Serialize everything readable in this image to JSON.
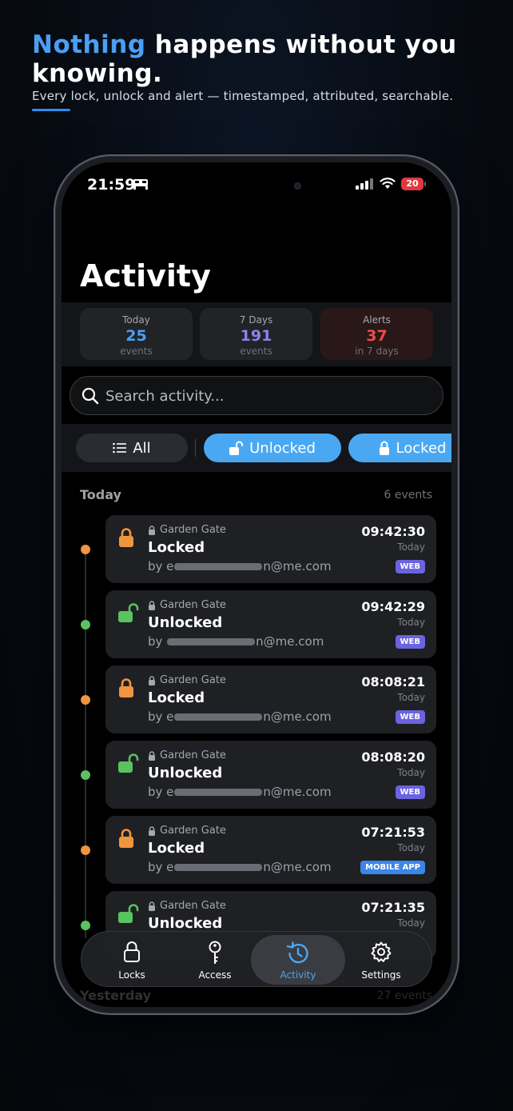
{
  "marketing": {
    "headline_accent": "Nothing",
    "headline_rest": " happens without you knowing.",
    "subline": "Every lock, unlock and alert — timestamped, attributed, searchable."
  },
  "status_bar": {
    "time": "21:59",
    "battery": "20"
  },
  "page_title": "Activity",
  "stats": [
    {
      "label": "Today",
      "value": "25",
      "sub": "events",
      "color": "#4a9ff5"
    },
    {
      "label": "7 Days",
      "value": "191",
      "sub": "events",
      "color": "#8b84f0"
    },
    {
      "label": "Alerts",
      "value": "37",
      "sub": "in 7 days",
      "color": "#ee4b4b"
    }
  ],
  "search": {
    "placeholder": "Search activity..."
  },
  "filters": {
    "all": "All",
    "unlocked": "Unlocked",
    "locked": "Locked"
  },
  "section": {
    "title": "Today",
    "count": "6 events"
  },
  "events": [
    {
      "device": "Garden Gate",
      "action": "Locked",
      "by_prefix": "by e",
      "by_suffix": "n@me.com",
      "time": "09:42:30",
      "day": "Today",
      "source": "WEB"
    },
    {
      "device": "Garden Gate",
      "action": "Unlocked",
      "by_prefix": "by ",
      "by_suffix": "n@me.com",
      "time": "09:42:29",
      "day": "Today",
      "source": "WEB"
    },
    {
      "device": "Garden Gate",
      "action": "Locked",
      "by_prefix": "by e",
      "by_suffix": "n@me.com",
      "time": "08:08:21",
      "day": "Today",
      "source": "WEB"
    },
    {
      "device": "Garden Gate",
      "action": "Unlocked",
      "by_prefix": "by e",
      "by_suffix": "n@me.com",
      "time": "08:08:20",
      "day": "Today",
      "source": "WEB"
    },
    {
      "device": "Garden Gate",
      "action": "Locked",
      "by_prefix": "by e",
      "by_suffix": "n@me.com",
      "time": "07:21:53",
      "day": "Today",
      "source": "MOBILE APP"
    },
    {
      "device": "Garden Gate",
      "action": "Unlocked",
      "by_prefix": "",
      "by_suffix": "",
      "time": "07:21:35",
      "day": "Today",
      "source": ""
    }
  ],
  "tabs": {
    "locks": "Locks",
    "access": "Access",
    "activity": "Activity",
    "settings": "Settings"
  },
  "next_section": {
    "title": "Yesterday",
    "count": "27 events"
  }
}
